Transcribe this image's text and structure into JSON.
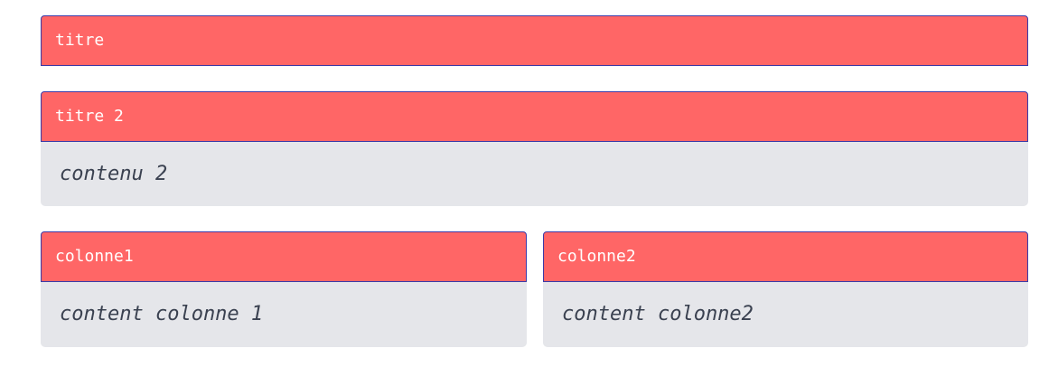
{
  "panels": [
    {
      "title": "titre"
    },
    {
      "title": "titre 2",
      "content": "contenu 2"
    }
  ],
  "columns": [
    {
      "title": "colonne1",
      "content": "content colonne 1"
    },
    {
      "title": "colonne2",
      "content": "content colonne2"
    }
  ],
  "colors": {
    "header_bg": "#ff6666",
    "header_border": "#3a3aa8",
    "header_text": "#ffffff",
    "body_bg": "#e5e6ea",
    "body_text": "#3a4150"
  }
}
